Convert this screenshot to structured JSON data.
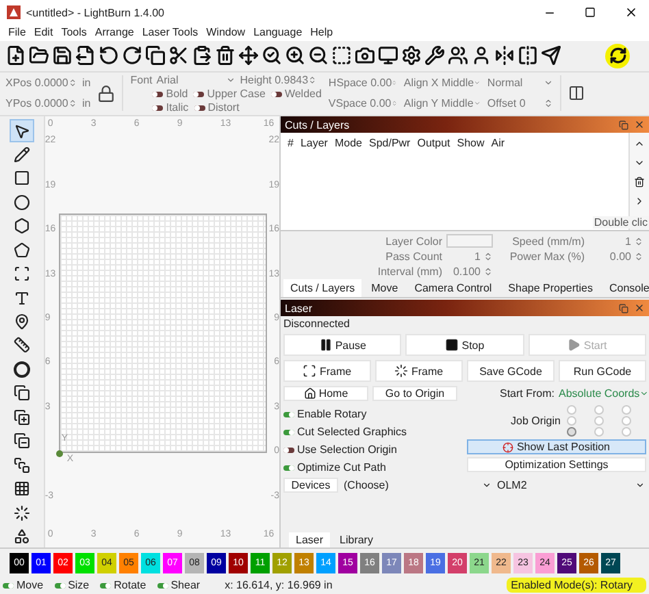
{
  "window": {
    "title": "<untitled> - LightBurn 1.4.00"
  },
  "menu": [
    "File",
    "Edit",
    "Tools",
    "Arrange",
    "Laser Tools",
    "Window",
    "Language",
    "Help"
  ],
  "properties": {
    "position": [
      {
        "label": "XPos",
        "value": "0.0000",
        "unit": "in"
      },
      {
        "label": "YPos",
        "value": "0.0000",
        "unit": "in"
      }
    ],
    "font": {
      "label": "Font",
      "value": "Arial"
    },
    "height": {
      "label": "Height",
      "value": "0.9843"
    },
    "text_toggles": [
      {
        "label": "Bold",
        "on": false
      },
      {
        "label": "Upper Case",
        "on": false
      },
      {
        "label": "Welded",
        "on": false
      },
      {
        "label": "Italic",
        "on": false
      },
      {
        "label": "Distort",
        "on": false
      }
    ],
    "spacing": [
      {
        "label": "HSpace",
        "value": "0.00"
      },
      {
        "label": "VSpace",
        "value": "0.00"
      }
    ],
    "align": [
      "Align X Middle",
      "Align Y Middle"
    ],
    "style": "Normal",
    "offset": {
      "label": "Offset",
      "value": "0"
    }
  },
  "tools": [
    {
      "selected": true
    },
    {
      "selected": false
    },
    {
      "selected": false
    },
    {
      "selected": false
    },
    {
      "selected": false
    },
    {
      "selected": false
    },
    {
      "selected": false
    },
    {
      "selected": false
    },
    {
      "selected": false
    },
    {
      "selected": false
    },
    {
      "selected": false
    },
    {
      "selected": false
    },
    {
      "selected": false
    },
    {
      "selected": false
    },
    {
      "selected": false
    },
    {
      "selected": false
    },
    {
      "selected": false
    },
    {
      "selected": false
    }
  ],
  "canvas": {
    "top_ruler": [
      "0",
      "3",
      "6",
      "9",
      "13",
      "16"
    ],
    "left_ruler": [
      "22",
      "19",
      "16",
      "13",
      "9",
      "6",
      "3",
      "-3"
    ],
    "right_ruler": [
      "22",
      "19",
      "16",
      "13",
      "9",
      "6",
      "3",
      "0",
      "-3"
    ],
    "bottom_ruler": [
      "0",
      "3",
      "6",
      "9",
      "13",
      "16"
    ],
    "axis_labels": [
      "Y",
      "X"
    ]
  },
  "cuts_layers": {
    "title": "Cuts / Layers",
    "columns": [
      "#",
      "Layer",
      "Mode",
      "Spd/Pwr",
      "Output",
      "Show",
      "Air"
    ],
    "tooltip": "Double clic",
    "layer_color": {
      "label": "Layer Color"
    },
    "speed": {
      "label": "Speed (mm/m)",
      "value": "1"
    },
    "pass_count": {
      "label": "Pass Count",
      "value": "1"
    },
    "power_max": {
      "label": "Power Max (%)",
      "value": "0.00"
    },
    "interval": {
      "label": "Interval (mm)",
      "value": "0.100"
    }
  },
  "panel_tabs": [
    {
      "label": "Cuts / Layers",
      "selected": true
    },
    {
      "label": "Move",
      "selected": false
    },
    {
      "label": "Camera Control",
      "selected": false
    },
    {
      "label": "Shape Properties",
      "selected": false
    },
    {
      "label": "Console",
      "selected": false
    }
  ],
  "laser": {
    "title": "Laser",
    "status": "Disconnected",
    "controls": [
      {
        "label": "Pause",
        "kind": "pause",
        "disabled": false
      },
      {
        "label": "Stop",
        "kind": "stop",
        "disabled": false
      },
      {
        "label": "Start",
        "kind": "start",
        "disabled": true
      }
    ],
    "actions": [
      {
        "label": "Frame",
        "kind": "rect-frame"
      },
      {
        "label": "Frame",
        "kind": "round-frame"
      },
      {
        "label": "Save GCode",
        "kind": "plain"
      },
      {
        "label": "Run GCode",
        "kind": "plain"
      }
    ],
    "moves": [
      {
        "label": "Home",
        "kind": "home"
      },
      {
        "label": "Go to Origin",
        "kind": "plain"
      }
    ],
    "start_from": {
      "label": "Start From:",
      "value": "Absolute Coords"
    },
    "toggles": [
      {
        "label": "Enable Rotary",
        "on": true
      },
      {
        "label": "Cut Selected Graphics",
        "on": true
      },
      {
        "label": "Use Selection Origin",
        "on": false
      },
      {
        "label": "Optimize Cut Path",
        "on": true
      }
    ],
    "job_origin": {
      "label": "Job Origin",
      "points": [
        {
          "selected": false
        },
        {
          "selected": false
        },
        {
          "selected": false
        },
        {
          "selected": false
        },
        {
          "selected": false
        },
        {
          "selected": false
        },
        {
          "selected": true
        },
        {
          "selected": false
        },
        {
          "selected": false
        }
      ]
    },
    "show_last_position": "Show Last Position",
    "optimization_settings": "Optimization Settings",
    "devices": {
      "button": "Devices",
      "device": "(Choose)",
      "port": "OLM2"
    }
  },
  "bottom_tabs": [
    {
      "label": "Laser",
      "selected": true
    },
    {
      "label": "Library",
      "selected": false
    }
  ],
  "palette": [
    {
      "label": "00",
      "color": "#000000"
    },
    {
      "label": "01",
      "color": "#0000ff"
    },
    {
      "label": "02",
      "color": "#ff0000"
    },
    {
      "label": "03",
      "color": "#00e000"
    },
    {
      "label": "04",
      "color": "#d0d000"
    },
    {
      "label": "05",
      "color": "#ff8000"
    },
    {
      "label": "06",
      "color": "#00e0e0"
    },
    {
      "label": "07",
      "color": "#ff00ff"
    },
    {
      "label": "08",
      "color": "#b4b4b4"
    },
    {
      "label": "09",
      "color": "#0000a0"
    },
    {
      "label": "10",
      "color": "#a00000"
    },
    {
      "label": "11",
      "color": "#00a000"
    },
    {
      "label": "12",
      "color": "#a0a000"
    },
    {
      "label": "13",
      "color": "#c08000"
    },
    {
      "label": "14",
      "color": "#00a0ff"
    },
    {
      "label": "15",
      "color": "#a000a0"
    },
    {
      "label": "16",
      "color": "#808080"
    },
    {
      "label": "17",
      "color": "#7d87b9"
    },
    {
      "label": "18",
      "color": "#bb7784"
    },
    {
      "label": "19",
      "color": "#4a6fe3"
    },
    {
      "label": "20",
      "color": "#d33f6a"
    },
    {
      "label": "21",
      "color": "#8cd78c"
    },
    {
      "label": "22",
      "color": "#f0b98d"
    },
    {
      "label": "23",
      "color": "#f6c4e1"
    },
    {
      "label": "24",
      "color": "#fa9ed4"
    },
    {
      "label": "25",
      "color": "#500a78"
    },
    {
      "label": "26",
      "color": "#b45a00"
    },
    {
      "label": "27",
      "color": "#004754"
    }
  ],
  "status_bar": {
    "toggles": [
      {
        "label": "Move",
        "on": true
      },
      {
        "label": "Size",
        "on": true
      },
      {
        "label": "Rotate",
        "on": true
      },
      {
        "label": "Shear",
        "on": true
      }
    ],
    "coords": "x: 16.614, y: 16.969 in",
    "mode": "Enabled Mode(s): Rotary"
  }
}
